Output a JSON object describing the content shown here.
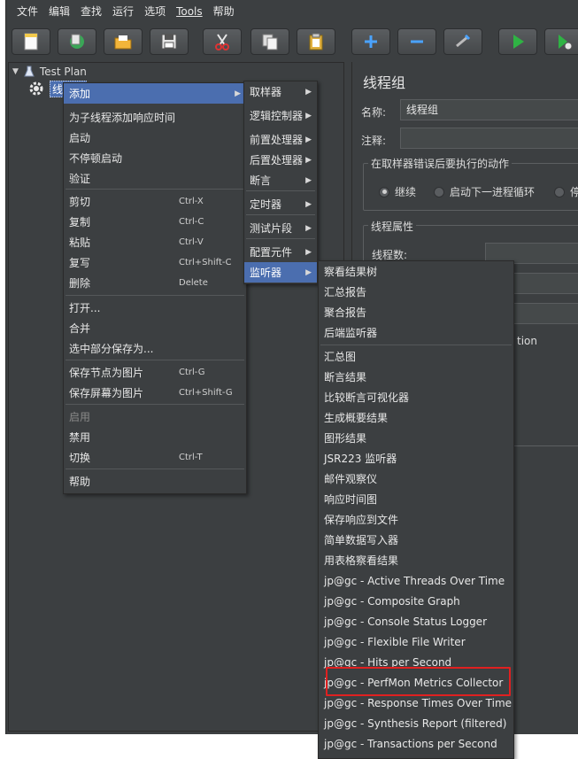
{
  "menubar": {
    "items": [
      "文件",
      "编辑",
      "查找",
      "运行",
      "选项",
      "Tools",
      "帮助"
    ]
  },
  "tree": {
    "root_label": "Test Plan",
    "child_label": "线程组"
  },
  "right_panel": {
    "title": "线程组",
    "name_label": "名称:",
    "name_value": "线程组",
    "comment_label": "注释:",
    "error_group_title": "在取样器错误后要执行的动作",
    "radio_continue": "继续",
    "radio_next_loop": "启动下一进程循环",
    "radio_stop_partial": "停",
    "thread_props_title": "线程属性",
    "thread_count_label": "线程数:",
    "partial_text": "tion"
  },
  "context_menu": {
    "items": [
      {
        "label": "添加",
        "submenu": true,
        "selected": true
      },
      {
        "label": "为子线程添加响应时间"
      },
      {
        "label": "启动"
      },
      {
        "label": "不停顿启动"
      },
      {
        "label": "验证"
      },
      {
        "label": "剪切",
        "accel": "Ctrl-X"
      },
      {
        "label": "复制",
        "accel": "Ctrl-C"
      },
      {
        "label": "粘贴",
        "accel": "Ctrl-V"
      },
      {
        "label": "复写",
        "accel": "Ctrl+Shift-C"
      },
      {
        "label": "删除",
        "accel": "Delete"
      },
      {
        "label": "打开..."
      },
      {
        "label": "合并"
      },
      {
        "label": "选中部分保存为..."
      },
      {
        "label": "保存节点为图片",
        "accel": "Ctrl-G"
      },
      {
        "label": "保存屏幕为图片",
        "accel": "Ctrl+Shift-G"
      },
      {
        "label": "启用",
        "disabled": true
      },
      {
        "label": "禁用"
      },
      {
        "label": "切换",
        "accel": "Ctrl-T"
      },
      {
        "label": "帮助"
      }
    ]
  },
  "add_submenu": {
    "items": [
      {
        "label": "取样器"
      },
      {
        "label": "逻辑控制器"
      },
      {
        "label": "前置处理器"
      },
      {
        "label": "后置处理器"
      },
      {
        "label": "断言"
      },
      {
        "label": "定时器"
      },
      {
        "label": "测试片段"
      },
      {
        "label": "配置元件"
      },
      {
        "label": "监听器",
        "selected": true
      }
    ]
  },
  "listener_submenu": {
    "items": [
      "察看结果树",
      "汇总报告",
      "聚合报告",
      "后端监听器",
      "汇总图",
      "断言结果",
      "比较断言可视化器",
      "生成概要结果",
      "图形结果",
      "JSR223 监听器",
      "邮件观察仪",
      "响应时间图",
      "保存响应到文件",
      "简单数据写入器",
      "用表格察看结果",
      "jp@gc - Active Threads Over Time",
      "jp@gc - Composite Graph",
      "jp@gc - Console Status Logger",
      "jp@gc - Flexible File Writer",
      "jp@gc - Hits per Second",
      "jp@gc - PerfMon Metrics Collector",
      "jp@gc - Response Times Over Time",
      "jp@gc - Synthesis Report (filtered)",
      "jp@gc - Transactions per Second"
    ],
    "highlighted": "jp@gc - PerfMon Metrics Collector"
  },
  "colors": {
    "background": "#3c3f41",
    "selection": "#4b6eaf",
    "highlight_box": "#e02020"
  }
}
